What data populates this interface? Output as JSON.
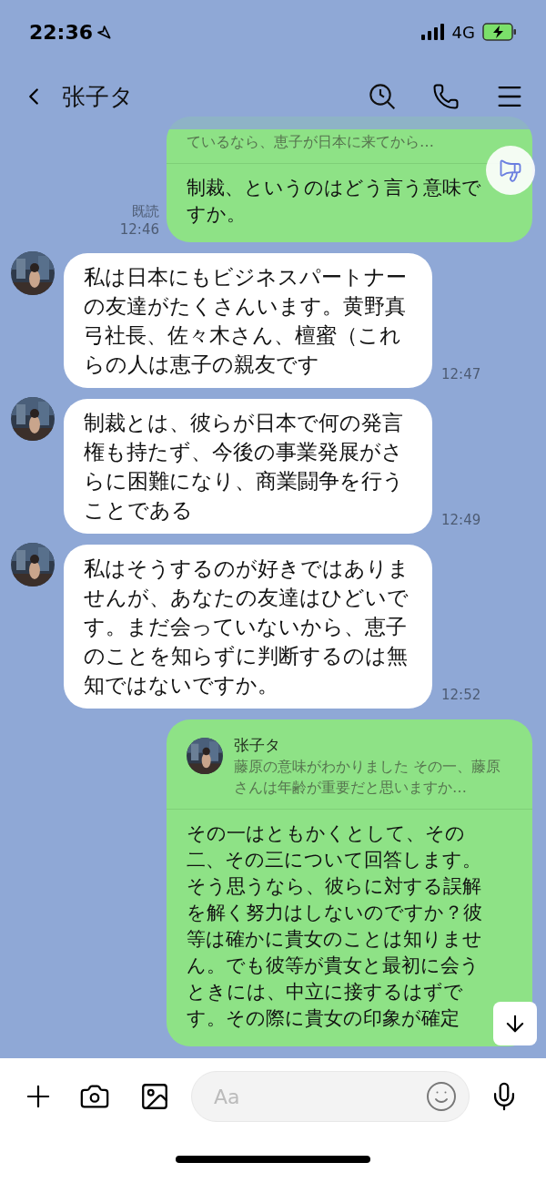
{
  "status_bar": {
    "time": "22:36",
    "network": "4G"
  },
  "header": {
    "title": "张子タ"
  },
  "messages": [
    {
      "kind": "outgoing",
      "quote": {
        "text": "ているなら、恵子が日本に来てから…"
      },
      "text": "制裁、というのはどう言う意味ですか。",
      "read_label": "既読",
      "time": "12:46"
    },
    {
      "kind": "incoming",
      "text": "私は日本にもビジネスパートナーの友達がたくさんいます。黄野真弓社長、佐々木さん、檀蜜（これらの人は恵子の親友です",
      "time": "12:47"
    },
    {
      "kind": "incoming",
      "text": "制裁とは、彼らが日本で何の発言権も持たず、今後の事業発展がさらに困難になり、商業闘争を行うことである",
      "time": "12:49"
    },
    {
      "kind": "incoming",
      "text": "私はそうするのが好きではありませんが、あなたの友達はひどいです。まだ会っていないから、恵子のことを知らずに判断するのは無知ではないですか。",
      "time": "12:52"
    },
    {
      "kind": "outgoing",
      "quote": {
        "sender": "张子タ",
        "text": "藤原の意味がわかりました その一、藤原さんは年齢が重要だと思いますか…"
      },
      "text": "その一はともかくとして、その二、その三について回答します。そう思うなら、彼らに対する誤解を解く努力はしないのですか？彼等は確かに貴女のことは知りません。でも彼等が貴女と最初に会うときには、中立に接するはずです。その際に貴女の印象が確定"
    }
  ],
  "input": {
    "placeholder": "Aa"
  }
}
